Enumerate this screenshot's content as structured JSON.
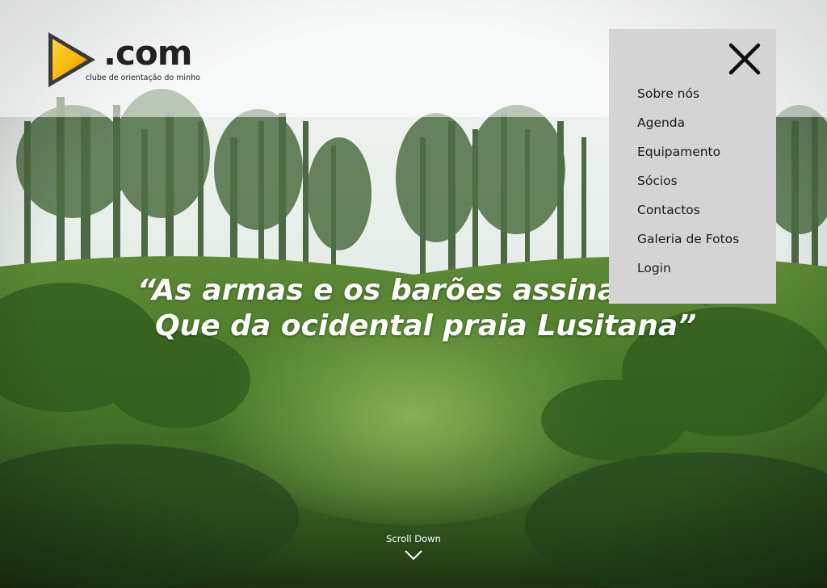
{
  "logo": {
    "domain_text": ".com",
    "subtitle": "clube de orientação do minho",
    "colors": {
      "triangle": "#f5b700",
      "triangle_dark": "#c98600"
    }
  },
  "menu": {
    "close_icon": "close-icon",
    "items": [
      {
        "label": "Sobre nós"
      },
      {
        "label": "Agenda"
      },
      {
        "label": "Equipamento"
      },
      {
        "label": "Sócios"
      },
      {
        "label": "Contactos"
      },
      {
        "label": "Galeria de Fotos"
      },
      {
        "label": "Login"
      }
    ]
  },
  "hero": {
    "quote_line1": "“As armas e os barões assinalados,",
    "quote_line2": "Que da ocidental praia Lusitana”"
  },
  "scroll": {
    "label": "Scroll Down",
    "icon": "chevron-down-icon"
  },
  "colors": {
    "menu_bg": "#d4d4d4",
    "text_light": "#ffffff",
    "text_dark": "#1a1a1a"
  }
}
